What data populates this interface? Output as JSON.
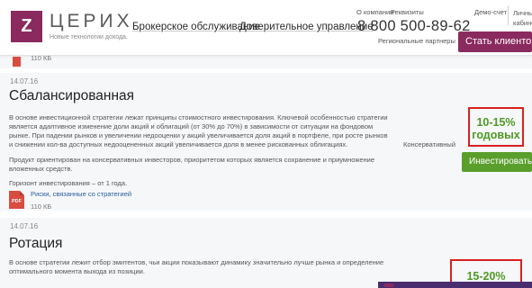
{
  "header": {
    "logo_letter": "Z",
    "logo_name": "ЦЕРИХ",
    "logo_tagline": "Новые технологии дохода.",
    "nav": {
      "broker": "Брокерское обслуживание",
      "trust": "Доверительное управление"
    },
    "top_links": {
      "about": "О компании",
      "requisites": "Реквизиты"
    },
    "phone": "8 800 500-89-62",
    "partners": "Региональные партнеры",
    "demo": "Демо-счет",
    "cabinet_line1": "Личный",
    "cabinet_line2": "кабинет",
    "client_button": "Стать клиентом"
  },
  "prev_card": {
    "file_size": "110 КБ"
  },
  "strategies": [
    {
      "date": "14.07.16",
      "title": "Сбалансированная",
      "desc1": "В основе инвестиционной стратегии лежат принципы стоимостного инвестирования. Ключевой особенностью стратегии является адаптивное изменение доли акций и облигаций (от 30% до 70%) в зависимости от ситуации на фондовом рынке. При падении рынков и увеличении недооценки у акций увеличивается доля акций в портфеле, при росте рынков и снижении кол-ва доступных недооцененных акций увеличивается доля в менее рискованных облигациях.",
      "desc2": "Продукт ориентирован на консервативных инвесторов, приоритетом которых является сохранение и приумножение вложенных средств.",
      "horizon": "Горизонт инвестирования – от 1 года.",
      "risk_profile": "Консервативный",
      "yield_value": "10-15%",
      "yield_unit": "годовых",
      "invest_button": "Инвестировать",
      "risks_link": "Риски, связанные со стратегией",
      "pdf_label": "PDF",
      "file_size": "110 КБ"
    },
    {
      "date": "14.07.16",
      "title": "Ротация",
      "desc1": "В основе стратегии лежит отбор эмитентов, чьи акции показывают динамику значительно лучше рынка и определение оптимального момента выхода из позиции.",
      "yield_value": "15-20%"
    }
  ],
  "colors": {
    "brand": "#8a2a5e",
    "invest_green": "#5a9e2c",
    "yield_green": "#4f9a22",
    "highlight_red": "#d92020",
    "card_bg": "#f5f7f9"
  }
}
